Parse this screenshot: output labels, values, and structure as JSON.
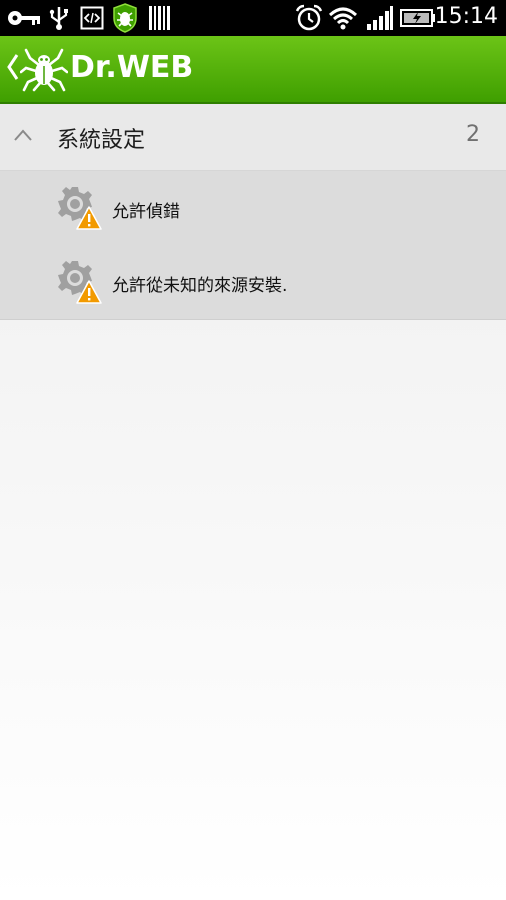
{
  "status_bar": {
    "time": "15:14",
    "icons": [
      "key-icon",
      "usb-icon",
      "developer-icon",
      "drweb-status-icon",
      "barcode-icon",
      "alarm-icon",
      "wifi-icon",
      "signal-icon",
      "battery-charging-icon"
    ]
  },
  "app_bar": {
    "brand": "Dr.WEB"
  },
  "section": {
    "title": "系統設定",
    "count": "2"
  },
  "items": [
    {
      "label": "允許偵錯",
      "icon": "settings-warning-icon"
    },
    {
      "label": "允許從未知的來源安裝.",
      "icon": "settings-warning-icon"
    }
  ],
  "colors": {
    "app_bar": "#5ab40c",
    "warning": "#f29a00",
    "gear": "#9a9a9a"
  }
}
